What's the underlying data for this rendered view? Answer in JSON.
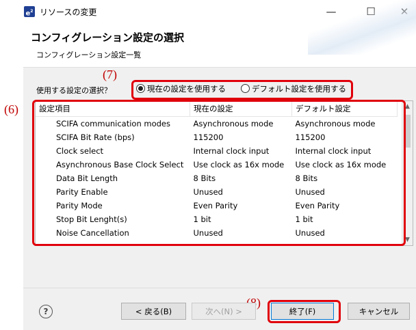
{
  "window": {
    "title": "リソースの変更",
    "app_icon_label": "e",
    "app_icon_sup": "2",
    "minimize": "—",
    "maximize": "☐",
    "close": "✕"
  },
  "header": {
    "title": "コンフィグレーション設定の選択",
    "subtitle": "コンフィグレーション設定一覧"
  },
  "selection": {
    "label": "使用する設定の選択？",
    "option_current": "現在の設定を使用する",
    "option_default": "デフォルト設定を使用する",
    "selected": "current"
  },
  "annotations": {
    "a6": "(6)",
    "a7": "(7)",
    "a8": "(8)",
    "color": "#e0000b"
  },
  "table": {
    "headers": [
      "設定項目",
      "現在の設定",
      "デフォルト設定"
    ],
    "rows": [
      [
        "SCIFA communication modes",
        "Asynchronous mode",
        "Asynchronous mode"
      ],
      [
        "SCIFA Bit Rate (bps)",
        "115200",
        "115200"
      ],
      [
        "Clock select",
        "Internal clock input",
        "Internal clock input"
      ],
      [
        "Asynchronous Base Clock Select",
        "Use clock as 16x mode",
        "Use clock as 16x mode"
      ],
      [
        "Data Bit Length",
        "8 Bits",
        "8 Bits"
      ],
      [
        "Parity Enable",
        "Unused",
        "Unused"
      ],
      [
        "Parity Mode",
        "Even Parity",
        "Even Parity"
      ],
      [
        "Stop Bit Lenght(s)",
        "1 bit",
        "1 bit"
      ],
      [
        "Noise Cancellation",
        "Unused",
        "Unused"
      ]
    ]
  },
  "buttons": {
    "help": "?",
    "back": "< 戻る(B)",
    "next": "次へ(N) >",
    "finish": "終了(F)",
    "cancel": "キャンセル"
  }
}
